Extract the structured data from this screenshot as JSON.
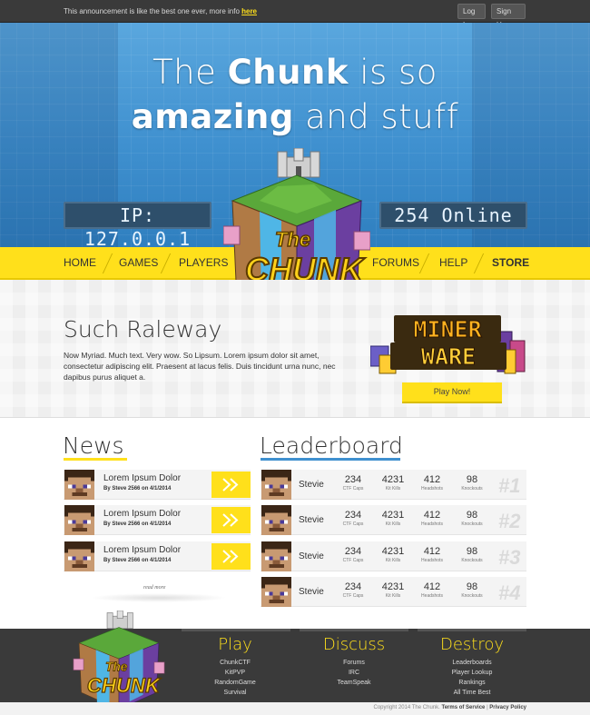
{
  "announcement": {
    "text": "This announcement is like the best one ever, more info ",
    "link": "here"
  },
  "auth": {
    "login": "Log In",
    "signup": "Sign Up"
  },
  "hero": {
    "line1_pre": "The ",
    "line1_bold": "Chunk",
    "line1_post": " is so",
    "line2_bold": "amazing",
    "line2_post": " and stuff"
  },
  "server": {
    "ip": "IP: 127.0.0.1",
    "online": "254 Online"
  },
  "nav": {
    "left": [
      "HOME",
      "GAMES",
      "PLAYERS"
    ],
    "right": [
      "FORUMS",
      "HELP",
      "STORE"
    ]
  },
  "logo": {
    "text1": "The",
    "text2": "CHUNK"
  },
  "promo": {
    "title": "Such Raleway",
    "text": "Now Myriad. Much text. Very wow. So Lipsum. Lorem ipsum dolor sit amet, consectetur adipiscing elit. Praesent at lacus felis. Duis tincidunt urna nunc, nec dapibus purus aliquet a.",
    "game_logo_1": "MINER",
    "game_logo_2": "WARE",
    "play_button": "Play Now!"
  },
  "news": {
    "title": "News",
    "accent": "#ffe01b",
    "items": [
      {
        "title": "Lorem Ipsum Dolor",
        "meta": "By Steve 2566 on 4/1/2014"
      },
      {
        "title": "Lorem Ipsum Dolor",
        "meta": "By Steve 2566 on 4/1/2014"
      },
      {
        "title": "Lorem Ipsum Dolor",
        "meta": "By Steve 2566 on 4/1/2014"
      }
    ],
    "read_more": "read more"
  },
  "leaderboard": {
    "title": "Leaderboard",
    "accent": "#3f90cf",
    "labels": {
      "caps": "CTF Caps",
      "kills": "Kit Kills",
      "headshots": "Headshots",
      "knockouts": "Knockouts"
    },
    "rows": [
      {
        "name": "Stevie",
        "caps": "234",
        "kills": "4231",
        "headshots": "412",
        "knockouts": "98",
        "rank": "#1"
      },
      {
        "name": "Stevie",
        "caps": "234",
        "kills": "4231",
        "headshots": "412",
        "knockouts": "98",
        "rank": "#2"
      },
      {
        "name": "Stevie",
        "caps": "234",
        "kills": "4231",
        "headshots": "412",
        "knockouts": "98",
        "rank": "#3"
      },
      {
        "name": "Stevie",
        "caps": "234",
        "kills": "4231",
        "headshots": "412",
        "knockouts": "98",
        "rank": "#4"
      }
    ]
  },
  "footer": {
    "play": {
      "title": "Play",
      "links": [
        "ChunkCTF",
        "KitPVP",
        "RandomGame",
        "Survival"
      ]
    },
    "discuss": {
      "title": "Discuss",
      "links": [
        "Forums",
        "IRC",
        "TeamSpeak"
      ]
    },
    "destroy": {
      "title": "Destroy",
      "links": [
        "Leaderboards",
        "Player Lookup",
        "Rankings",
        "All Time Best"
      ]
    },
    "copyright": "Copyright 2014 The Chunk.",
    "terms": "Terms of Service",
    "separator": "|",
    "privacy": "Privacy Policy"
  }
}
